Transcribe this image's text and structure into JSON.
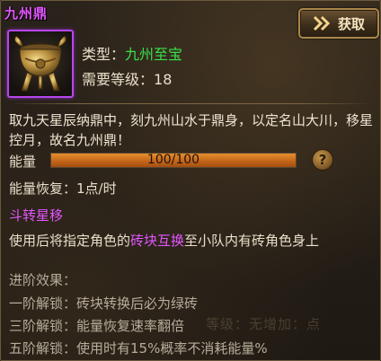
{
  "title": "九州鼎",
  "get_button": {
    "label": "获取",
    "icon": "double-chevron-right-icon"
  },
  "item_icon": "tripod-cauldron-icon",
  "attributes": {
    "type_label": "类型：",
    "type_value": "九州至宝",
    "level_label": "需要等级：",
    "level_value": "18"
  },
  "description": "取九天星辰纳鼎中，刻九州山水于鼎身，以定名山大川，移星控月，故名九州鼎！",
  "energy": {
    "label": "能量",
    "text": "100/100",
    "fraction": 1.0
  },
  "help_icon": "?",
  "energy_recovery": "能量恢复：1点/时",
  "skill": {
    "name": "斗转星移",
    "desc_before": "使用后将指定角色的",
    "desc_highlight": "砖块互换",
    "desc_after": "至小队内有砖角色身上"
  },
  "advance": {
    "title": "进阶效果：",
    "items": [
      "一阶解锁：砖块转换后必为绿砖",
      "三阶解锁：能量恢复速率翻倍",
      "五阶解锁：使用时有15%概率不消耗能量%"
    ]
  },
  "watermark": "等级：无增加：点",
  "colors": {
    "title": "#e455ff",
    "value_green": "#39e14a",
    "bar_fill": "#d2741f",
    "icon_border": "#b646f0"
  }
}
